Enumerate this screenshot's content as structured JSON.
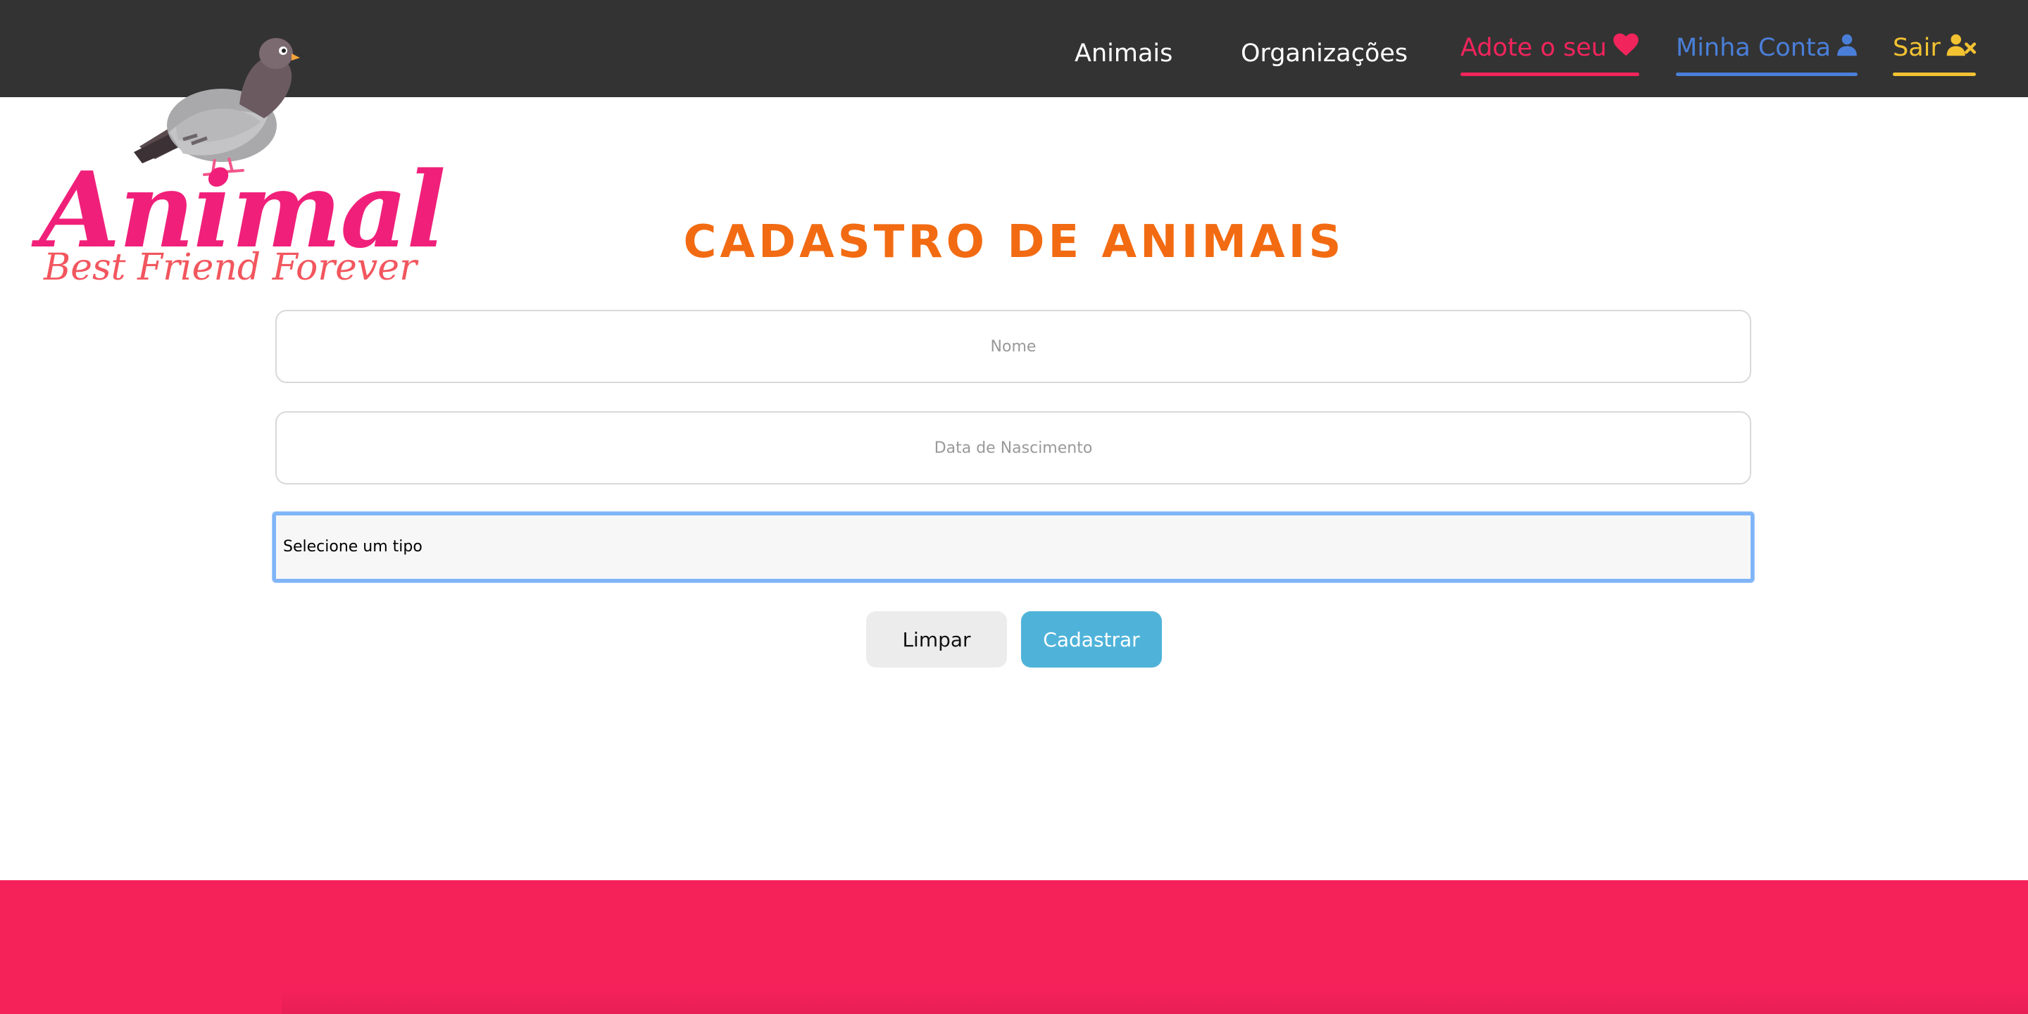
{
  "nav": {
    "animais": "Animais",
    "organizacoes": "Organizações",
    "adote": "Adote o seu",
    "conta": "Minha Conta",
    "sair": "Sair"
  },
  "icons": {
    "adote": "heart-icon",
    "conta": "user-icon",
    "sair": "user-remove-icon"
  },
  "colors": {
    "navbar": "#333333",
    "adote": "#f2245c",
    "conta": "#4a7fd9",
    "sair": "#f2c232",
    "title": "#f26b12",
    "primary_button": "#4fb3d9",
    "footer": "#f5225a",
    "logo": "#f0207a"
  },
  "logo": {
    "word": "Animal",
    "tagline": "Best Friend Forever"
  },
  "page": {
    "title": "CADASTRO DE ANIMAIS"
  },
  "form": {
    "nome_placeholder": "Nome",
    "nome_value": "",
    "data_placeholder": "Data de Nascimento",
    "data_value": "",
    "tipo_selected": "Selecione um tipo",
    "limpar_label": "Limpar",
    "cadastrar_label": "Cadastrar"
  }
}
